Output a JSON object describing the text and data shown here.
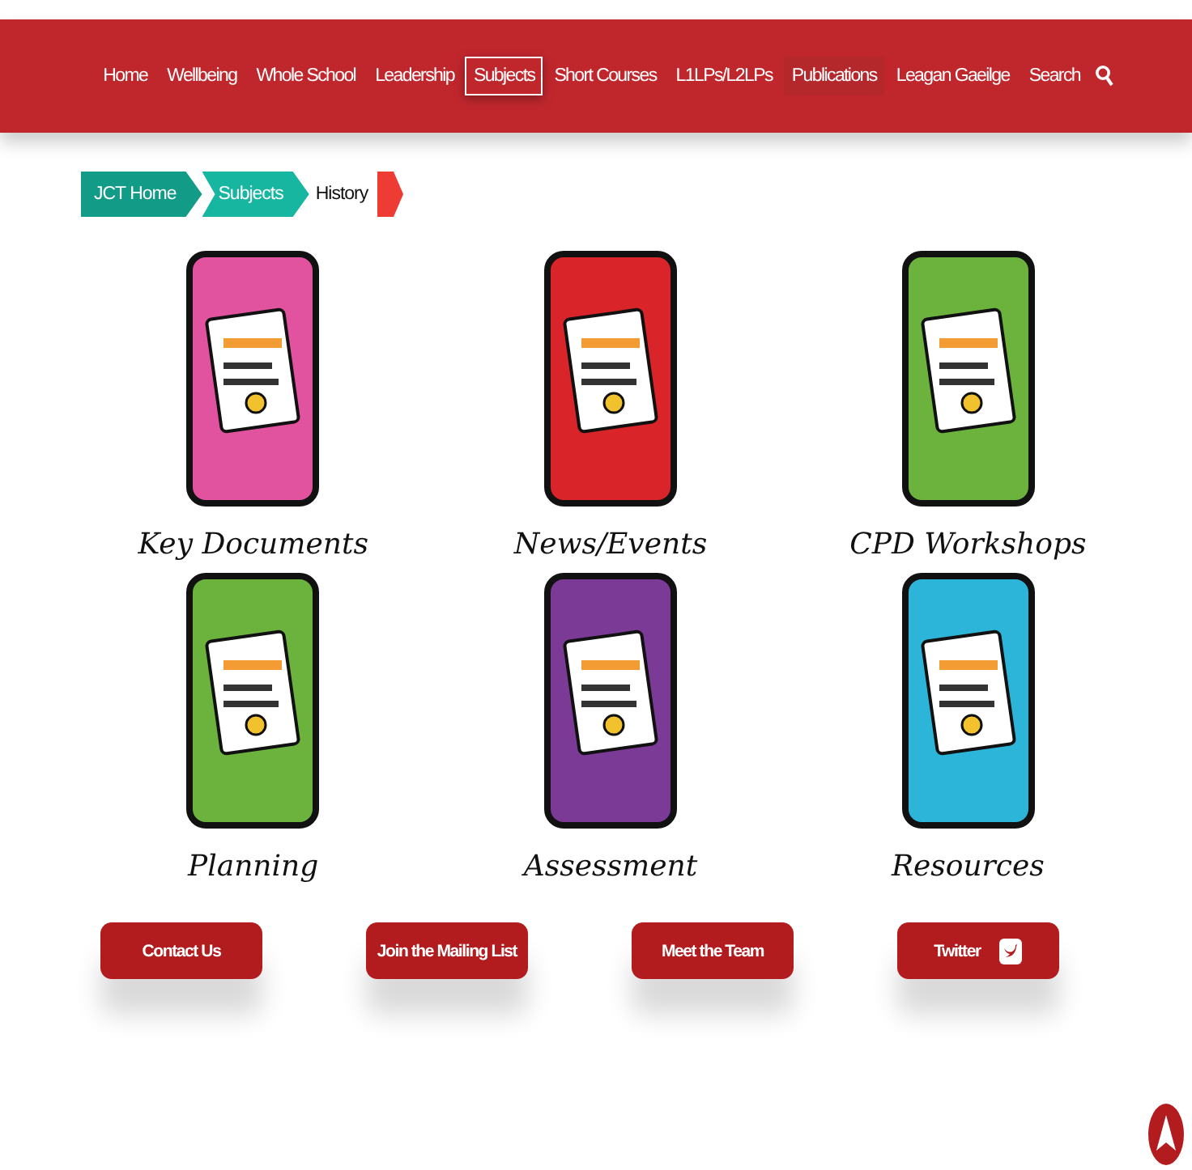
{
  "nav": {
    "items": [
      {
        "label": "Home",
        "selected": false,
        "hovered": false
      },
      {
        "label": "Wellbeing",
        "selected": false,
        "hovered": false
      },
      {
        "label": "Whole School",
        "selected": false,
        "hovered": false
      },
      {
        "label": "Leadership",
        "selected": false,
        "hovered": false
      },
      {
        "label": "Subjects",
        "selected": true,
        "hovered": false
      },
      {
        "label": "Short Courses",
        "selected": false,
        "hovered": false
      },
      {
        "label": "L1LPs/L2LPs",
        "selected": false,
        "hovered": false
      },
      {
        "label": "Publications",
        "selected": false,
        "hovered": true
      },
      {
        "label": "Leagan Gaeilge",
        "selected": false,
        "hovered": false
      }
    ],
    "search": "Search"
  },
  "breadcrumb": [
    "JCT Home",
    "Subjects",
    "History"
  ],
  "tiles": [
    {
      "label": "Key Documents",
      "color": "#e2539f"
    },
    {
      "label": "News/Events",
      "color": "#d9242a"
    },
    {
      "label": "CPD Workshops",
      "color": "#6cb33e"
    },
    {
      "label": "Planning",
      "color": "#6cb33e"
    },
    {
      "label": "Assessment",
      "color": "#7b3a96"
    },
    {
      "label": "Resources",
      "color": "#2cb5d8"
    }
  ],
  "footer_buttons": [
    {
      "label": "Contact Us",
      "kind": "text"
    },
    {
      "label": "Join the Mailing List",
      "kind": "text"
    },
    {
      "label": "Meet the Team",
      "kind": "text"
    },
    {
      "label": "Twitter",
      "kind": "twitter"
    }
  ]
}
